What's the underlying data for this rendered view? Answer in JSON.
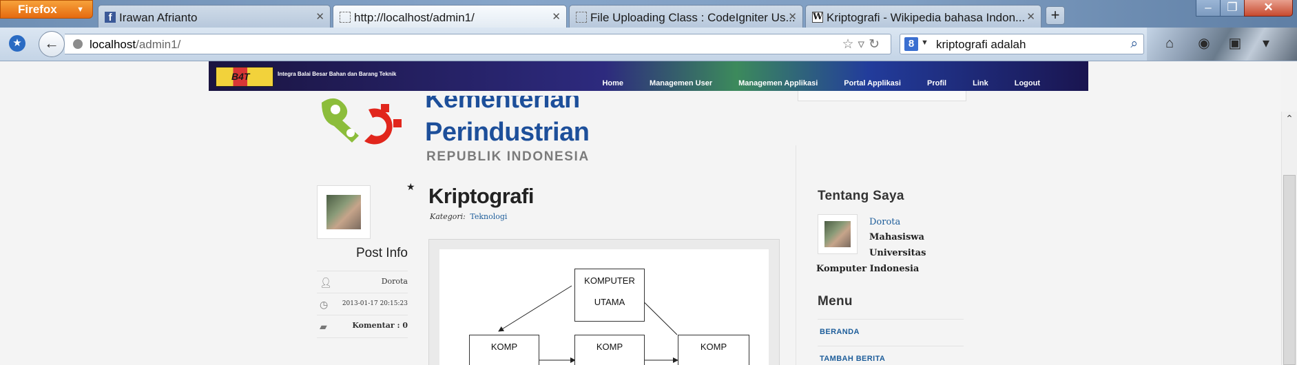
{
  "browser": {
    "menu_button": "Firefox",
    "tabs": [
      {
        "title": "Irawan Afrianto",
        "icon": "facebook-icon"
      },
      {
        "title": "http://localhost/admin1/",
        "icon": "blank-page-icon"
      },
      {
        "title": "File Uploading Class : CodeIgniter Us...",
        "icon": "blank-page-icon"
      },
      {
        "title": "Kriptografi - Wikipedia bahasa Indon...",
        "icon": "wikipedia-icon"
      }
    ],
    "new_tab": "+",
    "url_host": "localhost",
    "url_path": "/admin1/",
    "search_value": "kriptografi adalah",
    "search_engine_letter": "8"
  },
  "site": {
    "banner_title": "Integra Balai Besar Bahan dan Barang Teknik",
    "banner_logo": "B4T",
    "menu": [
      "Home",
      "Managemen User",
      "Managemen Applikasi",
      "Portal Applikasi",
      "Profil",
      "Link",
      "Logout"
    ],
    "logo_line1": "Kementerian",
    "logo_line2": "Perindustrian",
    "logo_line3": "REPUBLIK INDONESIA"
  },
  "post_info": {
    "heading": "Post Info",
    "author": "Dorota",
    "date": "2013-01-17 20:15:23",
    "comments": "Komentar : 0"
  },
  "post": {
    "title": "Kriptografi",
    "category_label": "Kategori:",
    "category_value": "Teknologi"
  },
  "diagram": {
    "main_l1": "KOMPUTER",
    "main_l2": "UTAMA",
    "nodes": [
      "KOMP",
      "KOMP",
      "KOMP"
    ]
  },
  "about": {
    "heading": "Tentang Saya",
    "name": "Dorota",
    "line1": "Mahasiswa",
    "line2": "Universitas",
    "line3": "Komputer Indonesia"
  },
  "menu_widget": {
    "heading": "Menu",
    "items": [
      "BERANDA",
      "TAMBAH BERITA"
    ]
  },
  "colors": {
    "link": "#1d5d9a",
    "logo_blue": "#1d4f9a"
  }
}
